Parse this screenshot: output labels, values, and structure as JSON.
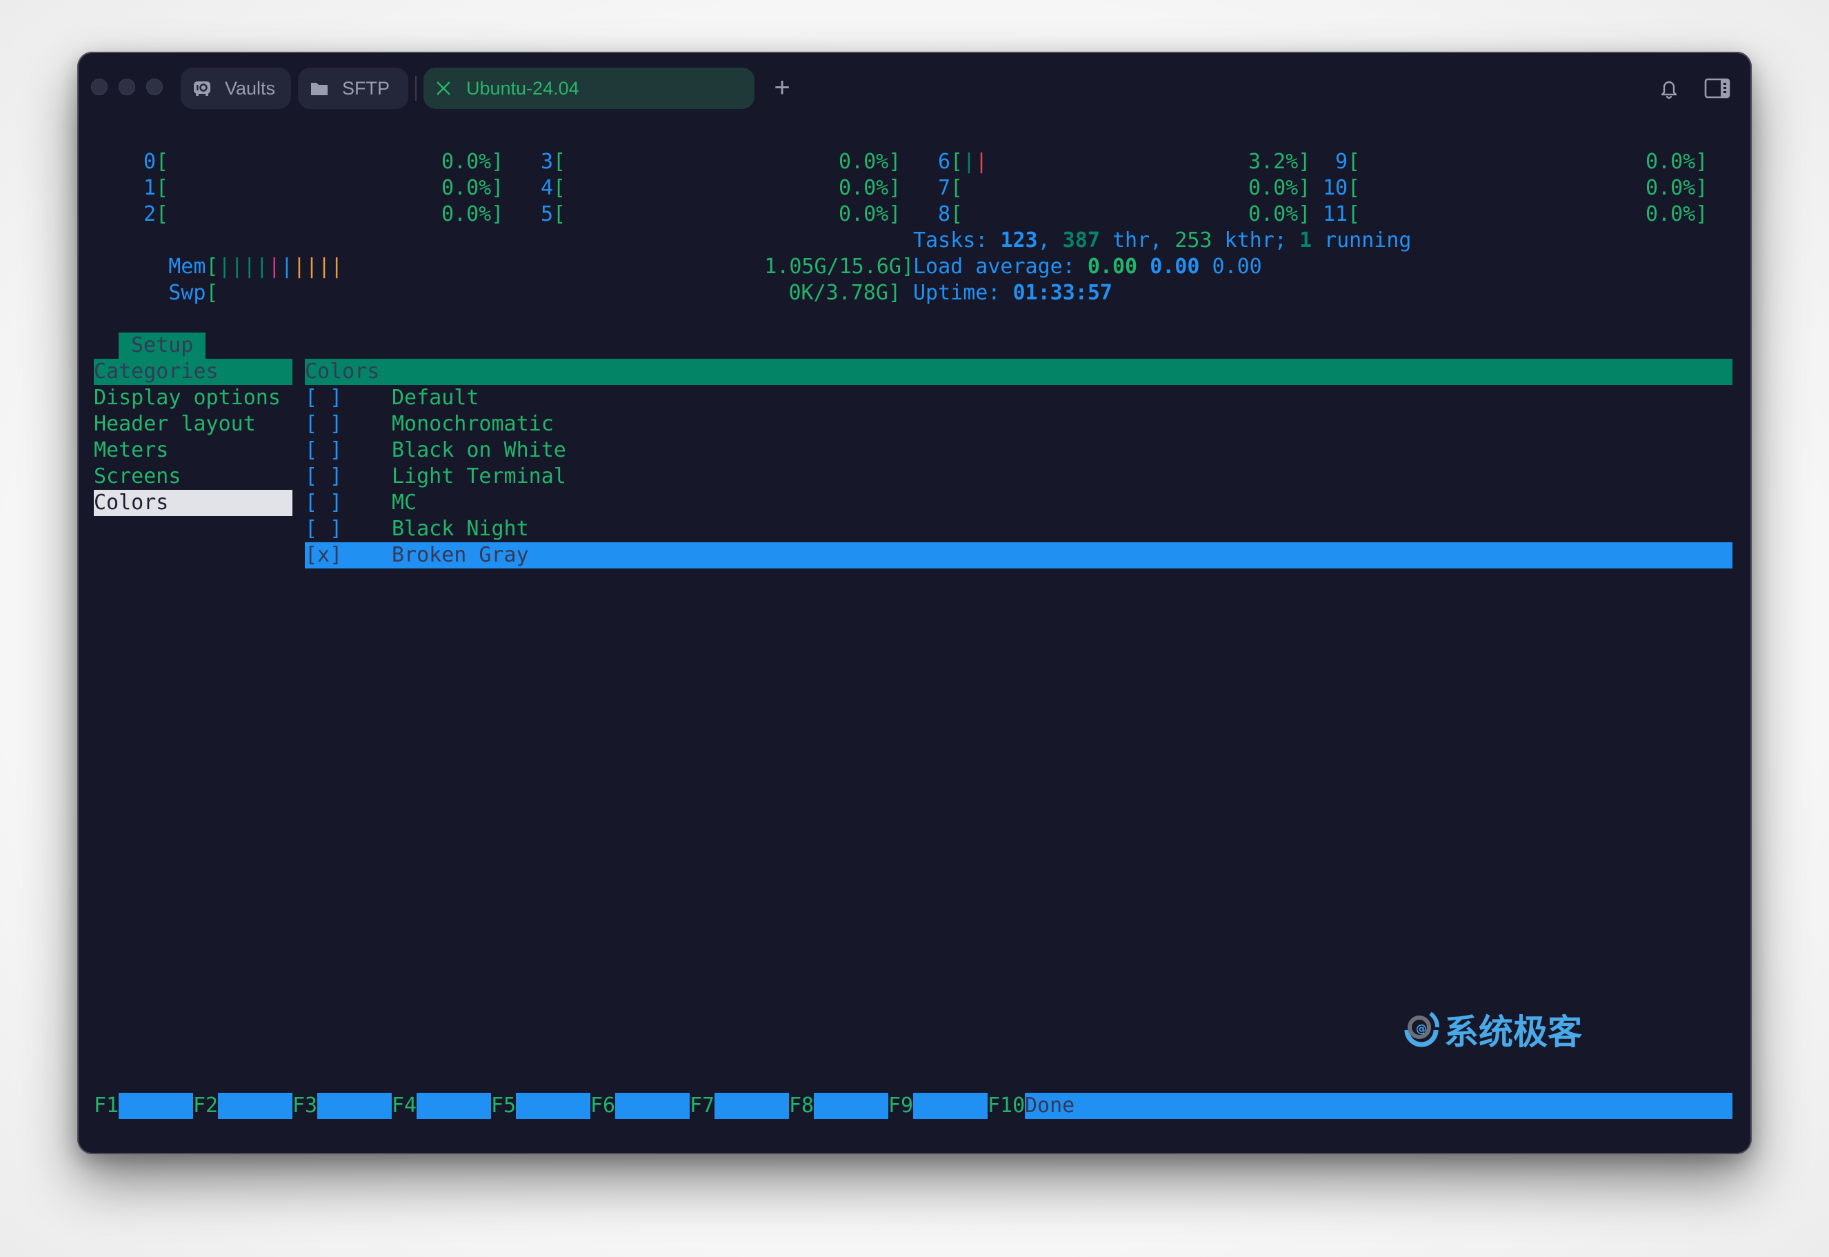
{
  "window": {
    "traffic_lights": [
      "close",
      "minimize",
      "zoom"
    ],
    "tabs": [
      {
        "label": "Vaults",
        "icon": "vault-icon",
        "active": false
      },
      {
        "label": "SFTP",
        "icon": "folder-icon",
        "active": false
      },
      {
        "label": "Ubuntu-24.04",
        "icon": "close-icon",
        "active": true
      }
    ],
    "new_tab_label": "+",
    "toolbar_icons": [
      "bell-icon",
      "sidebar-toggle-icon"
    ]
  },
  "meters": {
    "cpus": [
      {
        "id": "0",
        "percent": "0.0%",
        "bars": []
      },
      {
        "id": "1",
        "percent": "0.0%",
        "bars": []
      },
      {
        "id": "2",
        "percent": "0.0%",
        "bars": []
      },
      {
        "id": "3",
        "percent": "0.0%",
        "bars": []
      },
      {
        "id": "4",
        "percent": "0.0%",
        "bars": []
      },
      {
        "id": "5",
        "percent": "0.0%",
        "bars": []
      },
      {
        "id": "6",
        "percent": "3.2%",
        "bars": [
          "dgreen",
          "red"
        ]
      },
      {
        "id": "7",
        "percent": "0.0%",
        "bars": []
      },
      {
        "id": "8",
        "percent": "0.0%",
        "bars": []
      },
      {
        "id": "9",
        "percent": "0.0%",
        "bars": []
      },
      {
        "id": "10",
        "percent": "0.0%",
        "bars": []
      },
      {
        "id": "11",
        "percent": "0.0%",
        "bars": []
      }
    ],
    "mem": {
      "label": "Mem",
      "value": "1.05G/15.6G",
      "bars": [
        "dgreen",
        "dgreen",
        "dgreen",
        "dgreen",
        "pink",
        "blue",
        "orange",
        "orange",
        "orange",
        "orange"
      ]
    },
    "swp": {
      "label": "Swp",
      "value": "0K/3.78G"
    },
    "tasks": {
      "label": "Tasks: ",
      "count": "123",
      "sep": ", ",
      "threads": "387",
      "thr_label": " thr, ",
      "kthreads": "253",
      "kthr_label": " kthr; ",
      "running": "1",
      "running_label": " running"
    },
    "load": {
      "label": "Load average: ",
      "one": "0.00",
      "five": "0.00",
      "fifteen": "0.00"
    },
    "uptime": {
      "label": "Uptime: ",
      "value": "01:33:57"
    }
  },
  "setup": {
    "tab_label": "Setup",
    "categories_header": "Categories",
    "categories": [
      "Display options",
      "Header layout",
      "Meters",
      "Screens",
      "Colors"
    ],
    "selected_category": "Colors",
    "panel_header": "Colors",
    "color_schemes": [
      {
        "checkbox": "[ ]",
        "label": "Default",
        "checked": false
      },
      {
        "checkbox": "[ ]",
        "label": "Monochromatic",
        "checked": false
      },
      {
        "checkbox": "[ ]",
        "label": "Black on White",
        "checked": false
      },
      {
        "checkbox": "[ ]",
        "label": "Light Terminal",
        "checked": false
      },
      {
        "checkbox": "[ ]",
        "label": "MC",
        "checked": false
      },
      {
        "checkbox": "[ ]",
        "label": "Black Night",
        "checked": false
      },
      {
        "checkbox": "[x]",
        "label": "Broken Gray",
        "checked": true
      }
    ]
  },
  "function_bar": [
    {
      "key": "F1",
      "action": ""
    },
    {
      "key": "F2",
      "action": ""
    },
    {
      "key": "F3",
      "action": ""
    },
    {
      "key": "F4",
      "action": ""
    },
    {
      "key": "F5",
      "action": ""
    },
    {
      "key": "F6",
      "action": ""
    },
    {
      "key": "F7",
      "action": ""
    },
    {
      "key": "F8",
      "action": ""
    },
    {
      "key": "F9",
      "action": ""
    },
    {
      "key": "F10",
      "action": "Done"
    }
  ],
  "watermark": {
    "text": "系统极客"
  },
  "colors": {
    "terminal_bg": "#161729",
    "blue": "#2290f2",
    "green": "#22b56a",
    "dark_green": "#038466",
    "selection_blue": "#2090f2",
    "selection_gray": "#e2e3e8",
    "pink": "#d8337f",
    "red": "#e0474a",
    "orange": "#e89a42"
  }
}
